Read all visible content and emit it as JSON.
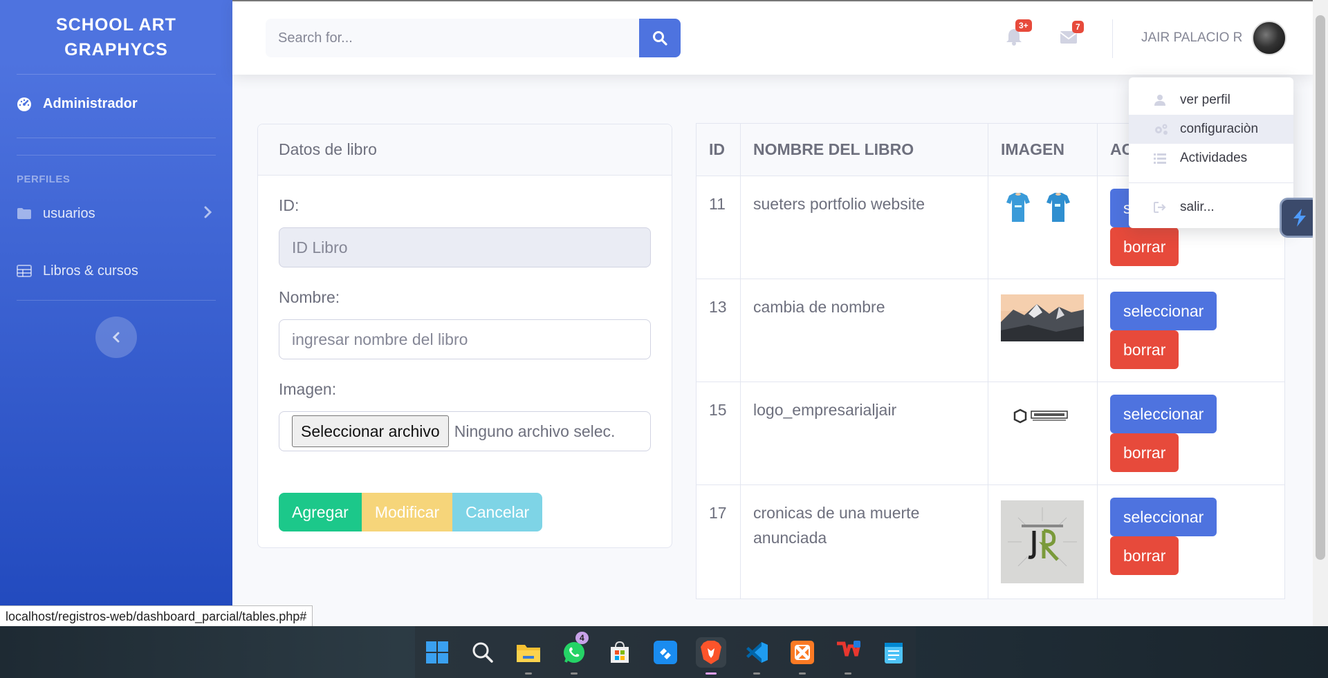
{
  "sidebar": {
    "brand": "SCHOOL ART GRAPHYCS",
    "items": [
      {
        "label": "Administrador",
        "icon": "dashboard-icon"
      },
      {
        "label": "usuarios",
        "icon": "folder-icon"
      },
      {
        "label": "Libros & cursos",
        "icon": "table-icon"
      }
    ],
    "heading": "PERFILES"
  },
  "topbar": {
    "search_placeholder": "Search for...",
    "alerts_badge": "3+",
    "messages_badge": "7",
    "user_name": "JAIR PALACIO R"
  },
  "user_menu": {
    "items": [
      "ver perfil",
      "configuraciòn",
      "Actividades"
    ],
    "logout": "salir..."
  },
  "form": {
    "title": "Datos de libro",
    "id_label": "ID:",
    "id_placeholder": "ID Libro",
    "name_label": "Nombre:",
    "name_placeholder": "ingresar nombre del libro",
    "image_label": "Imagen:",
    "file_button": "Seleccionar archivo",
    "file_status": "Ninguno archivo selec.",
    "buttons": {
      "add": "Agregar",
      "modify": "Modificar",
      "cancel": "Cancelar"
    }
  },
  "table": {
    "headers": [
      "ID",
      "NOMBRE DEL LIBRO",
      "IMAGEN",
      "AC"
    ],
    "rows": [
      {
        "id": "11",
        "name": "sueters portfolio website",
        "image": "t-shirts"
      },
      {
        "id": "13",
        "name": "cambia de nombre",
        "image": "mountains"
      },
      {
        "id": "15",
        "name": "logo_empresarialjair",
        "image": "logo"
      },
      {
        "id": "17",
        "name": "cronicas de una muerte anunciada",
        "image": "jr-logo"
      }
    ],
    "select_label": "seleccionar",
    "delete_label": "borrar"
  },
  "status_url": "localhost/registros-web/dashboard_parcial/tables.php#",
  "taskbar": {
    "apps": [
      "windows-start",
      "search",
      "file-explorer",
      "whatsapp",
      "microsoft-store",
      "app-blue",
      "brave",
      "vscode",
      "xampp",
      "wps-office",
      "notepad"
    ],
    "whatsapp_badge": "4"
  },
  "colors": {
    "primary": "#4e73df",
    "danger": "#e74a3b",
    "success": "#1cc88a",
    "warning": "#f6d57a",
    "info": "#7ed4e6"
  }
}
